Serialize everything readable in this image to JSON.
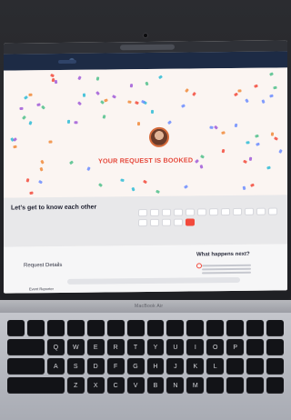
{
  "browser": {
    "url_text": "",
    "nav_links": [
      "",
      "",
      "",
      "",
      "",
      "",
      "",
      ""
    ],
    "nav_right": [
      "",
      ""
    ]
  },
  "hero": {
    "booked_text": "YOUR REQUEST IS BOOKED",
    "booked_sub": ""
  },
  "panel": {
    "title": "Let's get to know each other",
    "subtitle": "",
    "tags": [
      {
        "label": "",
        "active": false
      },
      {
        "label": "",
        "active": false
      },
      {
        "label": "",
        "active": false
      },
      {
        "label": "",
        "active": false
      },
      {
        "label": "",
        "active": false
      },
      {
        "label": "",
        "active": false
      },
      {
        "label": "",
        "active": false
      },
      {
        "label": "",
        "active": false
      },
      {
        "label": "",
        "active": false
      },
      {
        "label": "",
        "active": false
      },
      {
        "label": "",
        "active": false
      },
      {
        "label": "",
        "active": false
      },
      {
        "label": "",
        "active": false
      },
      {
        "label": "",
        "active": false
      },
      {
        "label": "",
        "active": false
      },
      {
        "label": "",
        "active": false
      },
      {
        "label": "",
        "active": true
      }
    ]
  },
  "lower": {
    "request_title": "Request Details",
    "what_title": "What happens next?",
    "field_label": "Event Reporter"
  },
  "laptop": {
    "brand": "MacBook Air",
    "keys_row1": [
      "",
      "",
      "",
      "",
      "",
      "",
      "",
      "",
      "",
      "",
      "",
      "",
      "",
      ""
    ],
    "keys_row2": [
      "",
      "Q",
      "W",
      "E",
      "R",
      "T",
      "Y",
      "U",
      "I",
      "O",
      "P",
      "",
      ""
    ],
    "keys_row3": [
      "",
      "A",
      "S",
      "D",
      "F",
      "G",
      "H",
      "J",
      "K",
      "L",
      "",
      "",
      ""
    ],
    "keys_row4": [
      "",
      "Z",
      "X",
      "C",
      "V",
      "B",
      "N",
      "M",
      "",
      "",
      "",
      ""
    ]
  },
  "colors": {
    "accent": "#e5473a",
    "nav_bg": "#1d2b45",
    "confetti": [
      "#f08a3a",
      "#a05bd8",
      "#4fbf8b",
      "#6b8cff",
      "#f24a3c",
      "#2dbbd6"
    ]
  }
}
